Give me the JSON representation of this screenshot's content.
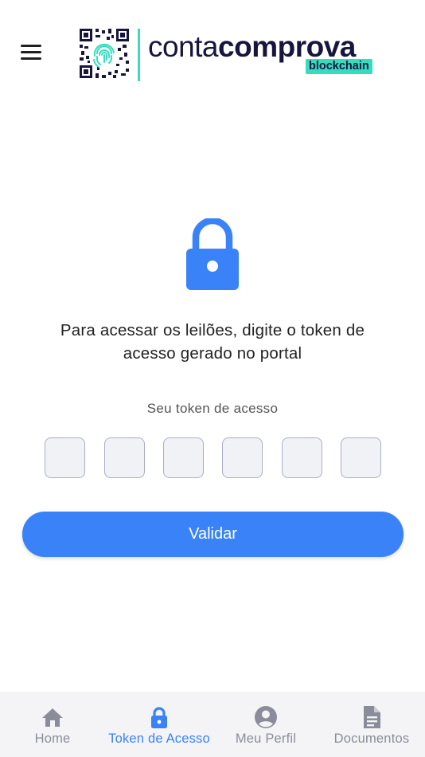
{
  "header": {
    "logo": {
      "word_regular": "conta",
      "word_bold": "comprova",
      "tag": "blockchain",
      "accent_color": "#37dcc0",
      "text_color": "#15153d"
    }
  },
  "main": {
    "icon": "lock-icon",
    "instruction_line1": "Para acessar os leilões, digite o token de",
    "instruction_line2": "acesso gerado no portal",
    "token_label": "Seu token de acesso",
    "token_fields": [
      "",
      "",
      "",
      "",
      "",
      ""
    ],
    "validate_label": "Validar",
    "primary_color": "#3a82f7"
  },
  "tabbar": {
    "tabs": [
      {
        "label": "Home",
        "icon": "home-icon",
        "active": false
      },
      {
        "label": "Token de Acesso",
        "icon": "lock-icon",
        "active": true
      },
      {
        "label": "Meu Perfil",
        "icon": "user-circle-icon",
        "active": false
      },
      {
        "label": "Documentos",
        "icon": "document-icon",
        "active": false
      }
    ],
    "inactive_color": "#8a8d99",
    "active_color": "#3a82f7"
  }
}
